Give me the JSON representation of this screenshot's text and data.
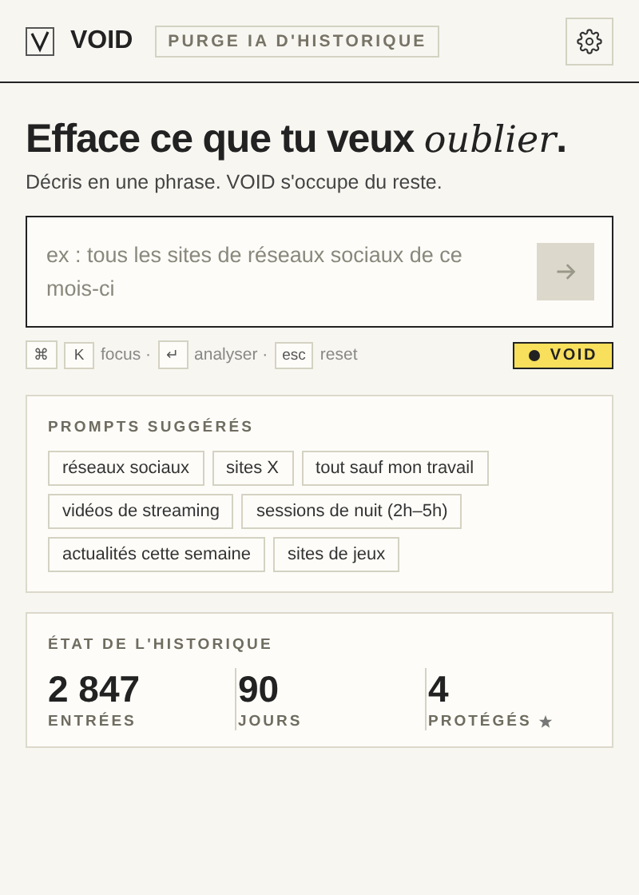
{
  "header": {
    "logo_text": "VOID",
    "tag": "PURGE IA D'HISTORIQUE"
  },
  "hero": {
    "title": "Efface ce que tu veux *oublier*.",
    "subtitle": "Décris en une phrase. VOID s'occupe du reste."
  },
  "prompt": {
    "placeholder": "ex : tous les sites de réseaux sociaux de ce mois-ci"
  },
  "hints": [
    {
      "kind": "key",
      "text": "⌘"
    },
    {
      "kind": "key",
      "text": "K"
    },
    {
      "kind": "text",
      "text": "focus ·"
    },
    {
      "kind": "key",
      "text": "↵"
    },
    {
      "kind": "text",
      "text": "analyser ·"
    },
    {
      "kind": "key",
      "text": "esc"
    },
    {
      "kind": "text",
      "text": "reset"
    }
  ],
  "status_badge": "VOID",
  "suggestions": {
    "title": "PROMPTS SUGGÉRÉS",
    "items": [
      "réseaux sociaux",
      "sites X",
      "tout sauf mon travail",
      "vidéos de streaming",
      "sessions de nuit (2h–5h)",
      "actualités cette semaine",
      "sites de jeux"
    ]
  },
  "stats": {
    "title": "ÉTAT DE L'HISTORIQUE",
    "items": [
      {
        "value": "2 847",
        "label": "ENTRÉES",
        "starred": false
      },
      {
        "value": "90",
        "label": "JOURS",
        "starred": false
      },
      {
        "value": "4",
        "label": "PROTÉGÉS",
        "starred": true
      }
    ]
  }
}
